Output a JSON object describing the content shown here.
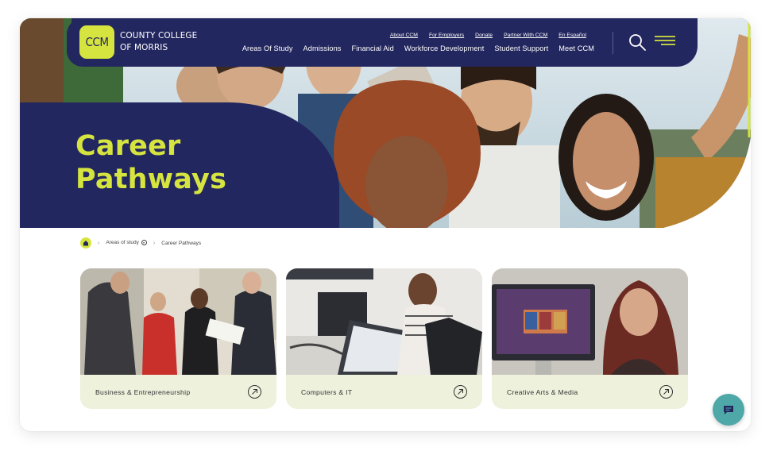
{
  "brand": {
    "logo_mark": "CCM",
    "logo_line1": "COUNTY COLLEGE",
    "logo_line2": "OF MORRIS",
    "accent": "#d6e43f",
    "navy": "#23275f",
    "chat_color": "#4fa8a8"
  },
  "header": {
    "utility_links": [
      "About CCM",
      "For Employers",
      "Donate",
      "Partner With CCM",
      "En Español"
    ],
    "main_nav": [
      "Areas Of Study",
      "Admissions",
      "Financial Aid",
      "Workforce Development",
      "Student Support",
      "Meet CCM"
    ],
    "search_icon": "search-icon",
    "menu_icon": "hamburger-menu-icon"
  },
  "hero": {
    "title_line1": "Career",
    "title_line2": "Pathways"
  },
  "breadcrumb": {
    "home_icon": "home-icon",
    "items": [
      "Areas of study",
      "Career Pathways"
    ]
  },
  "cards": [
    {
      "label": "Business & Entrepreneurship",
      "icon": "arrow-up-right-icon"
    },
    {
      "label": "Computers & IT",
      "icon": "arrow-up-right-icon"
    },
    {
      "label": "Creative Arts & Media",
      "icon": "arrow-up-right-icon"
    }
  ],
  "chat": {
    "icon": "chat-icon"
  }
}
